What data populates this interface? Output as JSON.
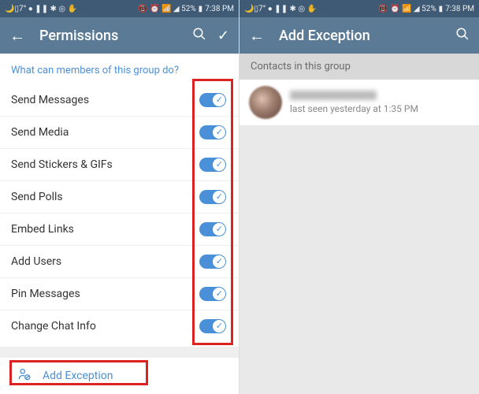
{
  "statusbar": {
    "left_icons": "🌙▯7° ● ❚❚ ✱ ◎ ✋",
    "signal": "📵 ⏰ 📶 ◢ 52%",
    "battery_icon": "▮",
    "time": "7:38 PM"
  },
  "left": {
    "title": "Permissions",
    "subtitle": "What can members of this group do?",
    "permissions": [
      {
        "label": "Send Messages"
      },
      {
        "label": "Send Media"
      },
      {
        "label": "Send Stickers & GIFs"
      },
      {
        "label": "Send Polls"
      },
      {
        "label": "Embed Links"
      },
      {
        "label": "Add Users"
      },
      {
        "label": "Pin Messages"
      },
      {
        "label": "Change Chat Info"
      }
    ],
    "add_exception": "Add Exception"
  },
  "right": {
    "title": "Add Exception",
    "group_header": "Contacts in this group",
    "contact_status": "last seen yesterday at 1:35 PM"
  }
}
